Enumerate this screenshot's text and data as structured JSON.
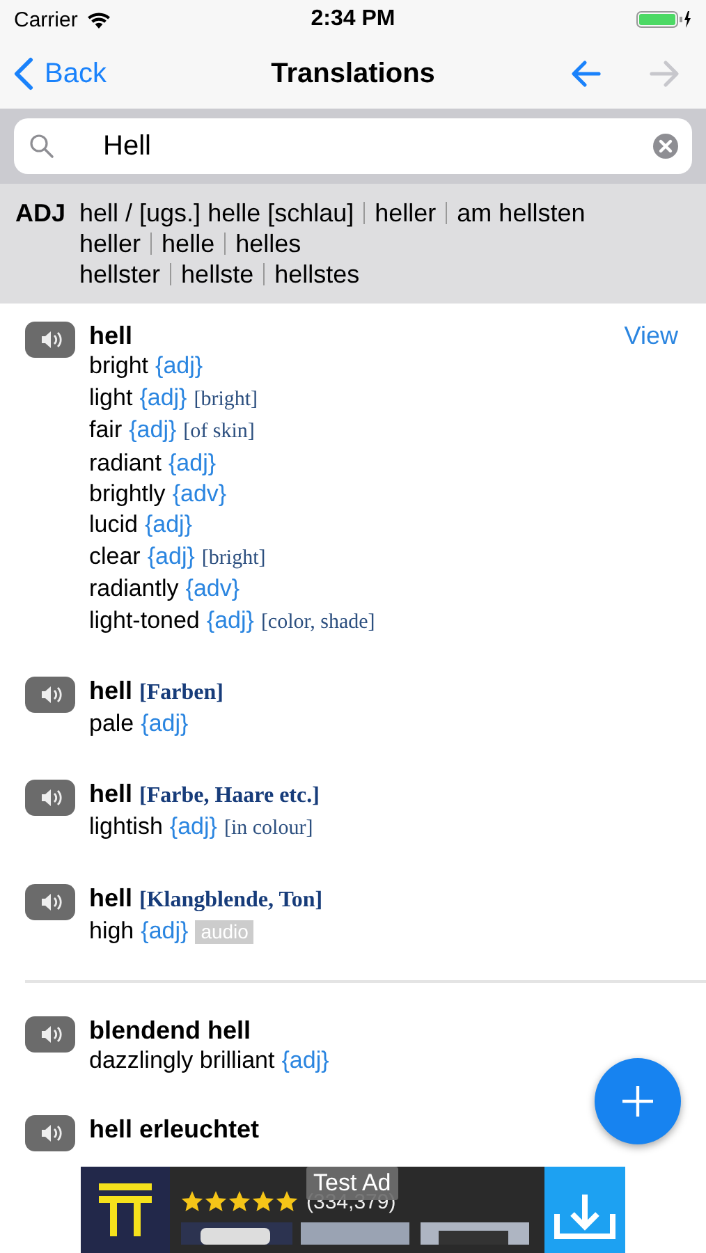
{
  "status_bar": {
    "carrier": "Carrier",
    "time": "2:34 PM"
  },
  "nav": {
    "back": "Back",
    "title": "Translations",
    "history_back": {
      "disabled": false
    },
    "history_forward": {
      "disabled": true
    }
  },
  "search": {
    "value": "Hell"
  },
  "forms": {
    "label": "ADJ",
    "lines": [
      [
        "hell / [ugs.] helle [schlau]",
        "heller",
        "am hellsten"
      ],
      [
        "heller",
        "helle",
        "helles"
      ],
      [
        "hellster",
        "hellste",
        "hellstes"
      ]
    ]
  },
  "sections": [
    {
      "entries": [
        {
          "word": "hell",
          "view": "View",
          "translations": [
            {
              "text": "bright",
              "pos": "{adj}"
            },
            {
              "text": "light",
              "pos": "{adj}",
              "note": "[bright]"
            },
            {
              "text": "fair",
              "pos": "{adj}",
              "note": "[of skin]"
            },
            {
              "text": "radiant",
              "pos": "{adj}"
            },
            {
              "text": "brightly",
              "pos": "{adv}"
            },
            {
              "text": "lucid",
              "pos": "{adj}"
            },
            {
              "text": "clear",
              "pos": "{adj}",
              "note": "[bright]"
            },
            {
              "text": "radiantly",
              "pos": "{adv}"
            },
            {
              "text": "light-toned",
              "pos": "{adj}",
              "note": "[color, shade]"
            }
          ]
        },
        {
          "word": "hell",
          "context": "[Farben]",
          "translations": [
            {
              "text": "pale",
              "pos": "{adj}"
            }
          ]
        },
        {
          "word": "hell",
          "context": "[Farbe, Haare etc.]",
          "translations": [
            {
              "text": "lightish",
              "pos": "{adj}",
              "note": "[in colour]"
            }
          ]
        },
        {
          "word": "hell",
          "context": "[Klangblende, Ton]",
          "translations": [
            {
              "text": "high",
              "pos": "{adj}",
              "tag": "audio"
            }
          ]
        }
      ]
    },
    {
      "entries": [
        {
          "word": "blendend hell",
          "translations": [
            {
              "text": "dazzlingly brilliant",
              "pos": "{adj}"
            }
          ]
        },
        {
          "word": "hell erleuchtet"
        }
      ]
    }
  ],
  "ad": {
    "badge": "Test Ad",
    "stars": 5,
    "rating_count": "(334,379)"
  }
}
